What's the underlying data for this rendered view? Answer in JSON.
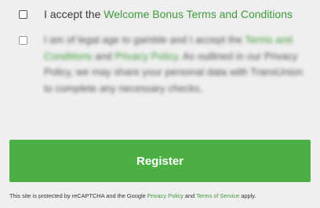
{
  "consents": {
    "bonus": {
      "prefix": "I accept the ",
      "link": "Welcome Bonus Terms and Conditions",
      "checked": false
    },
    "legal": {
      "prefix": "I am of legal age to gamble and I accept the ",
      "terms_link": "Terms and Conditions",
      "and": " and ",
      "privacy_link": "Privacy Policy",
      "suffix": ". As outlined in our Privacy Policy, we may share your personal data with TransUnion to complete any necessary checks.",
      "checked": false
    }
  },
  "register": {
    "label": "Register",
    "color": "#4caf44"
  },
  "recaptcha": {
    "prefix": "This site is protected by reCAPTCHA and the Google ",
    "privacy_link": "Privacy Policy",
    "and": " and ",
    "terms_link": "Terms of Service",
    "suffix": " apply."
  },
  "accent_color": "#3f9a3a"
}
